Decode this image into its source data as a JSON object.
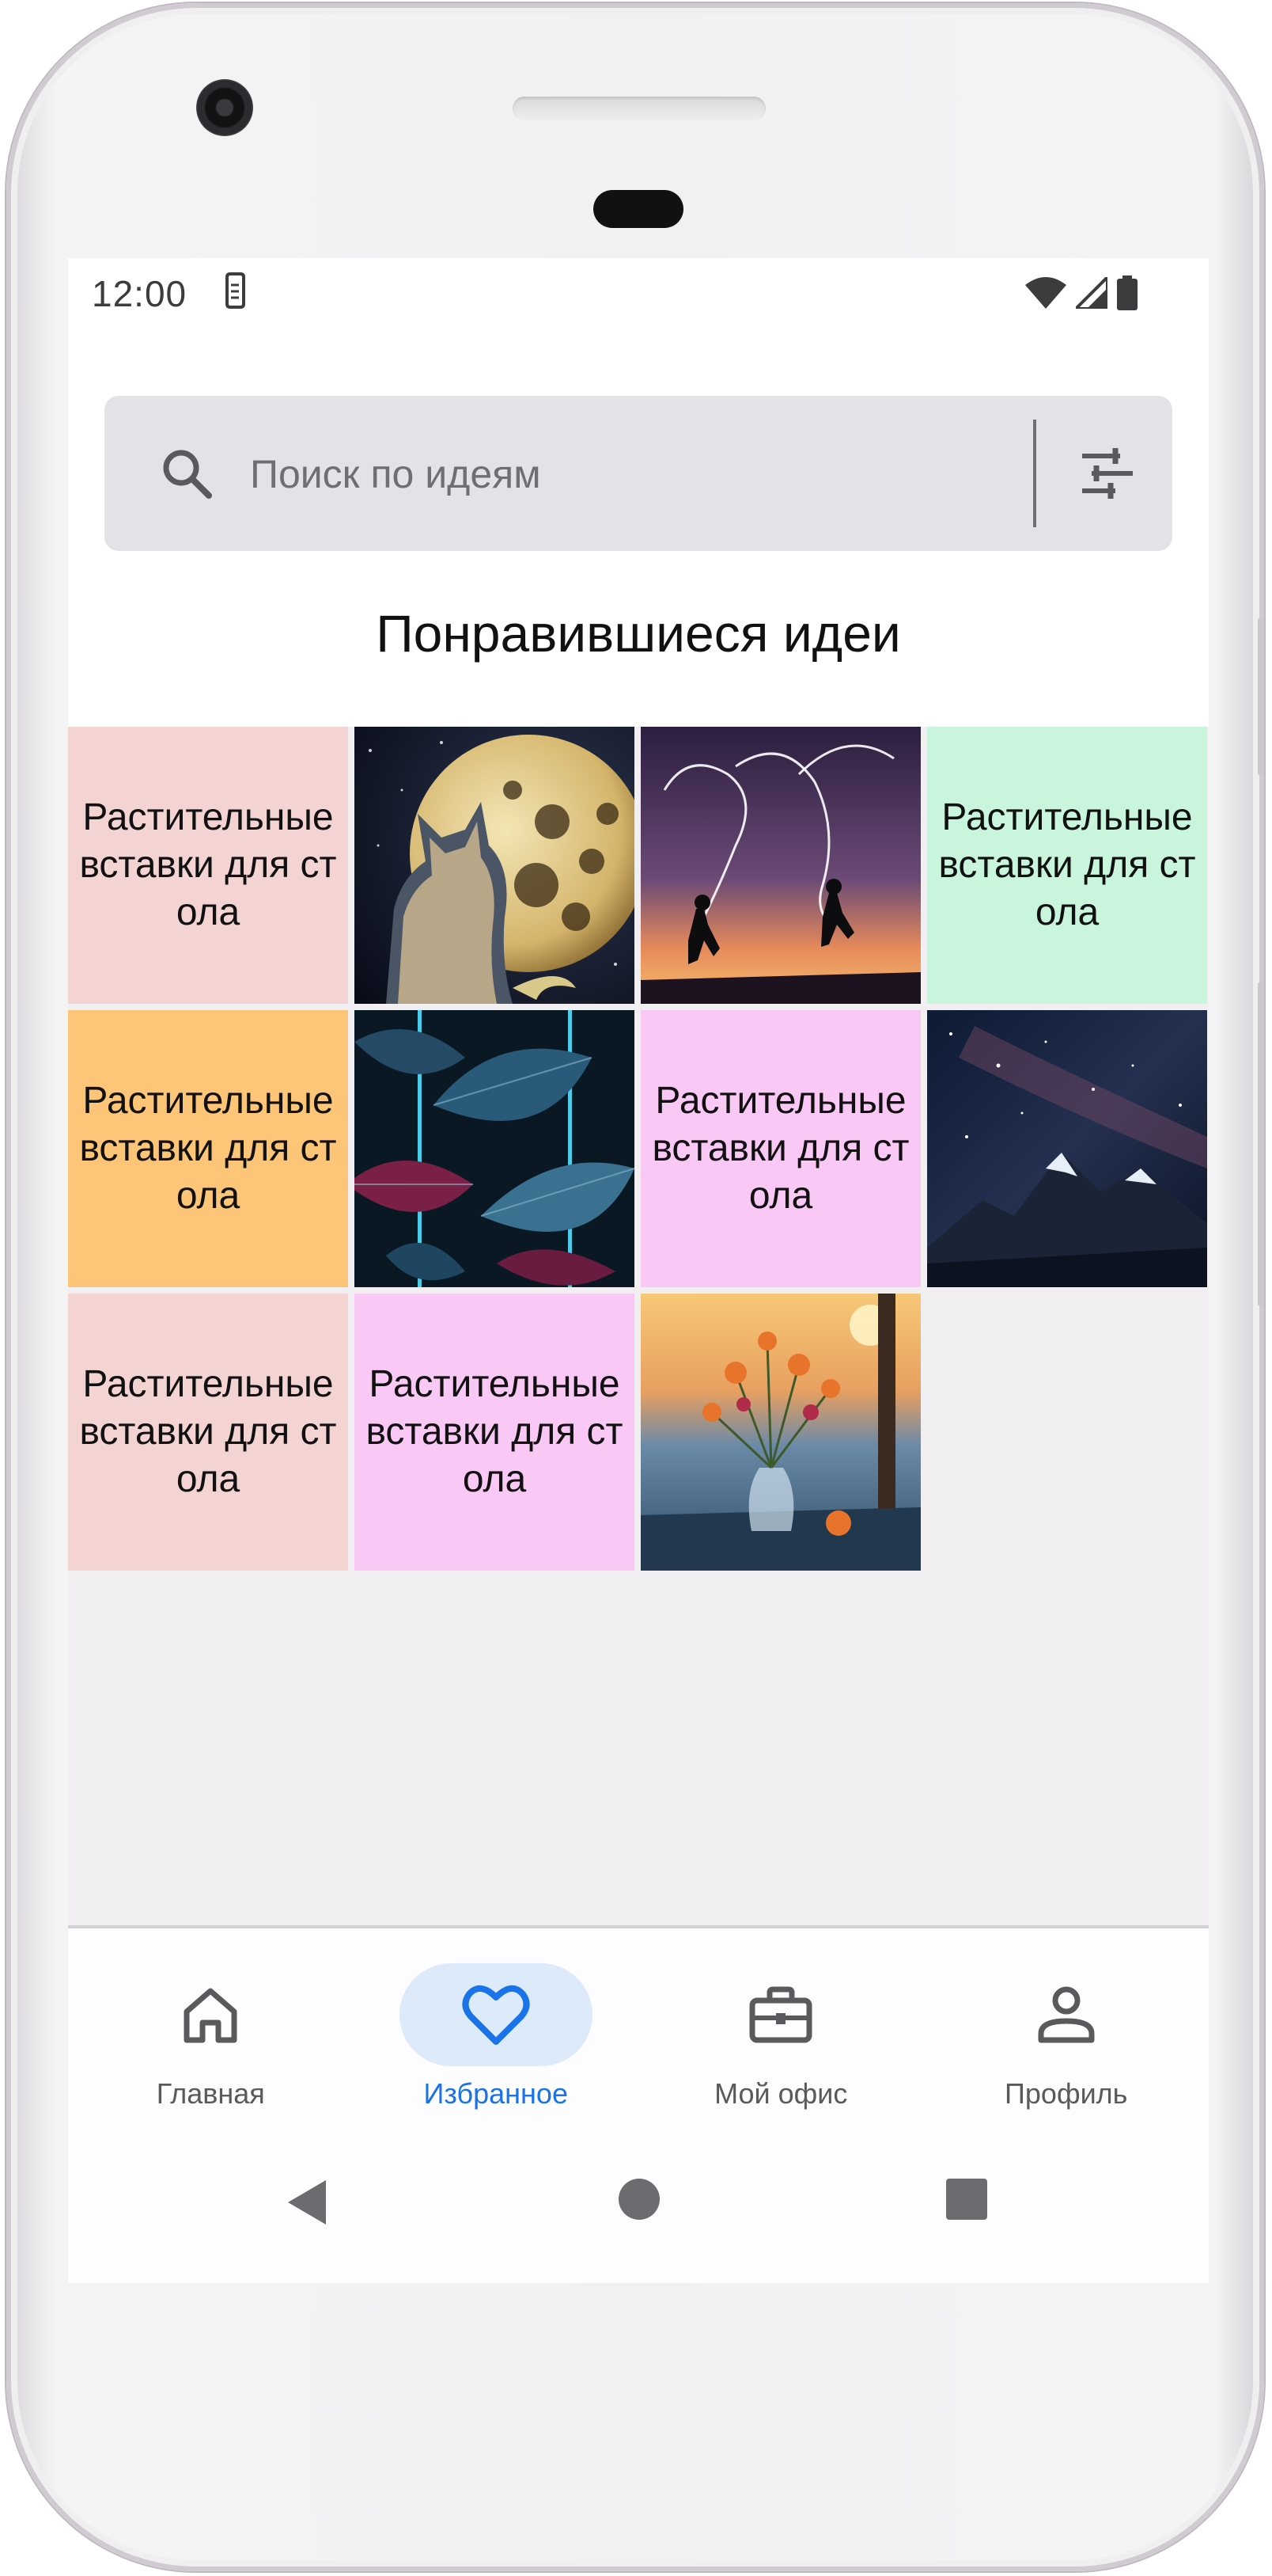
{
  "status_bar": {
    "time": "12:00"
  },
  "search": {
    "placeholder": "Поиск по идеям"
  },
  "page": {
    "title": "Понравившиеся идеи"
  },
  "tiles": [
    {
      "kind": "text",
      "text": "Растительные вставки для стола",
      "color": "#f4d3d3"
    },
    {
      "kind": "image",
      "subject": "cat-and-moon"
    },
    {
      "kind": "image",
      "subject": "couple-jumping-heart-sunset"
    },
    {
      "kind": "text",
      "text": "Растительные вставки для стола",
      "color": "#c9f5dc"
    },
    {
      "kind": "text",
      "text": "Растительные вставки для стола",
      "color": "#fcc577"
    },
    {
      "kind": "image",
      "subject": "neon-leaves"
    },
    {
      "kind": "text",
      "text": "Растительные вставки для стола",
      "color": "#f9c8f5"
    },
    {
      "kind": "image",
      "subject": "mountains-starry-sky"
    },
    {
      "kind": "text",
      "text": "Растительные вставки для стола",
      "color": "#f4d3d3"
    },
    {
      "kind": "text",
      "text": "Растительные вставки для стола",
      "color": "#f9c8f5"
    },
    {
      "kind": "image",
      "subject": "flowers-vase-sunset"
    }
  ],
  "bottom_nav": {
    "items": [
      {
        "label": "Главная",
        "icon": "home-icon",
        "active": false
      },
      {
        "label": "Избранное",
        "icon": "heart-icon",
        "active": true
      },
      {
        "label": "Мой офис",
        "icon": "briefcase-icon",
        "active": false
      },
      {
        "label": "Профиль",
        "icon": "person-icon",
        "active": false
      }
    ]
  },
  "colors": {
    "accent": "#1a73e8",
    "active_pill": "#ddeaf9",
    "search_background": "#e3e2e6",
    "content_background": "#f1eff2"
  }
}
